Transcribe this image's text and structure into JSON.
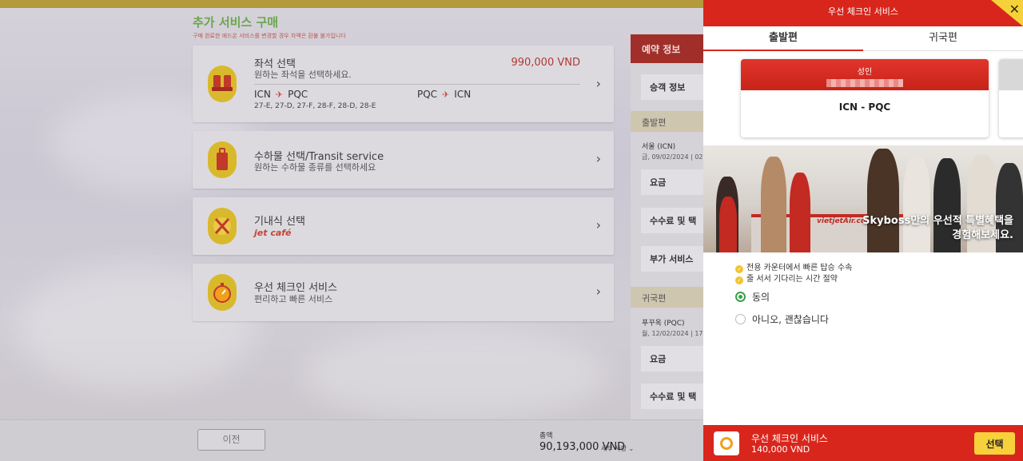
{
  "page": {
    "title": "추가 서비스 구매",
    "subtitle": "구매 완료한 애드온 서비스를 변경할 경우 차액은 환불 불가입니다"
  },
  "services": {
    "seat": {
      "title": "좌석 선택",
      "desc": "원하는 좌석을 선택하세요.",
      "price": "990,000 VND",
      "out_from": "ICN",
      "out_to": "PQC",
      "ret_from": "PQC",
      "ret_to": "ICN",
      "seats": "27-E, 27-D, 27-F, 28-F, 28-D, 28-E"
    },
    "baggage": {
      "title": "수하물 선택/Transit service",
      "desc": "원하는 수하물 종류를 선택하세요"
    },
    "meal": {
      "title": "기내식 선택",
      "brand": "jet café"
    },
    "checkin": {
      "title": "우선 체크인 서비스",
      "desc": "편리하고 빠른 서비스"
    }
  },
  "reservation": {
    "header": "예약 정보",
    "passenger": "승객 정보",
    "departure_section": "출발편",
    "departure_route": "서울 (ICN)",
    "departure_date": "금, 09/02/2024 | 02",
    "fare": "요금",
    "fees": "수수료 및 택",
    "addons": "부가 서비스",
    "return_section": "귀국편",
    "return_route": "푸꾸옥 (PQC)",
    "return_date": "월, 12/02/2024 | 17",
    "return_fare": "요금",
    "return_fees": "수수료 및 택"
  },
  "bottom": {
    "prev": "이전",
    "total_label": "총액",
    "total_value": "90,193,000 VND",
    "detail": "세부 사항"
  },
  "modal": {
    "title": "우선 체크인 서비스",
    "close": "✕",
    "tab_departure": "출발편",
    "tab_return": "귀국편",
    "passenger_type": "성인",
    "route": "ICN - PQC",
    "promo_line1": "Skyboss만의 우선적 특별혜택을",
    "promo_line2": "경험해보세요.",
    "counter_logo": "vietjetAir.com",
    "benefit1": "전용 카운터에서 빠른 탑승 수속",
    "benefit2": "줄 서서 기다리는 시간 절약",
    "option_agree": "동의",
    "option_decline": "아니오, 괜찮습니다",
    "footer_name": "우선 체크인 서비스",
    "footer_price": "140,000 VND",
    "select": "선택"
  },
  "colors": {
    "brand_red": "#d9261c",
    "brand_yellow": "#f7d13b",
    "accept_green": "#3aa04a"
  }
}
